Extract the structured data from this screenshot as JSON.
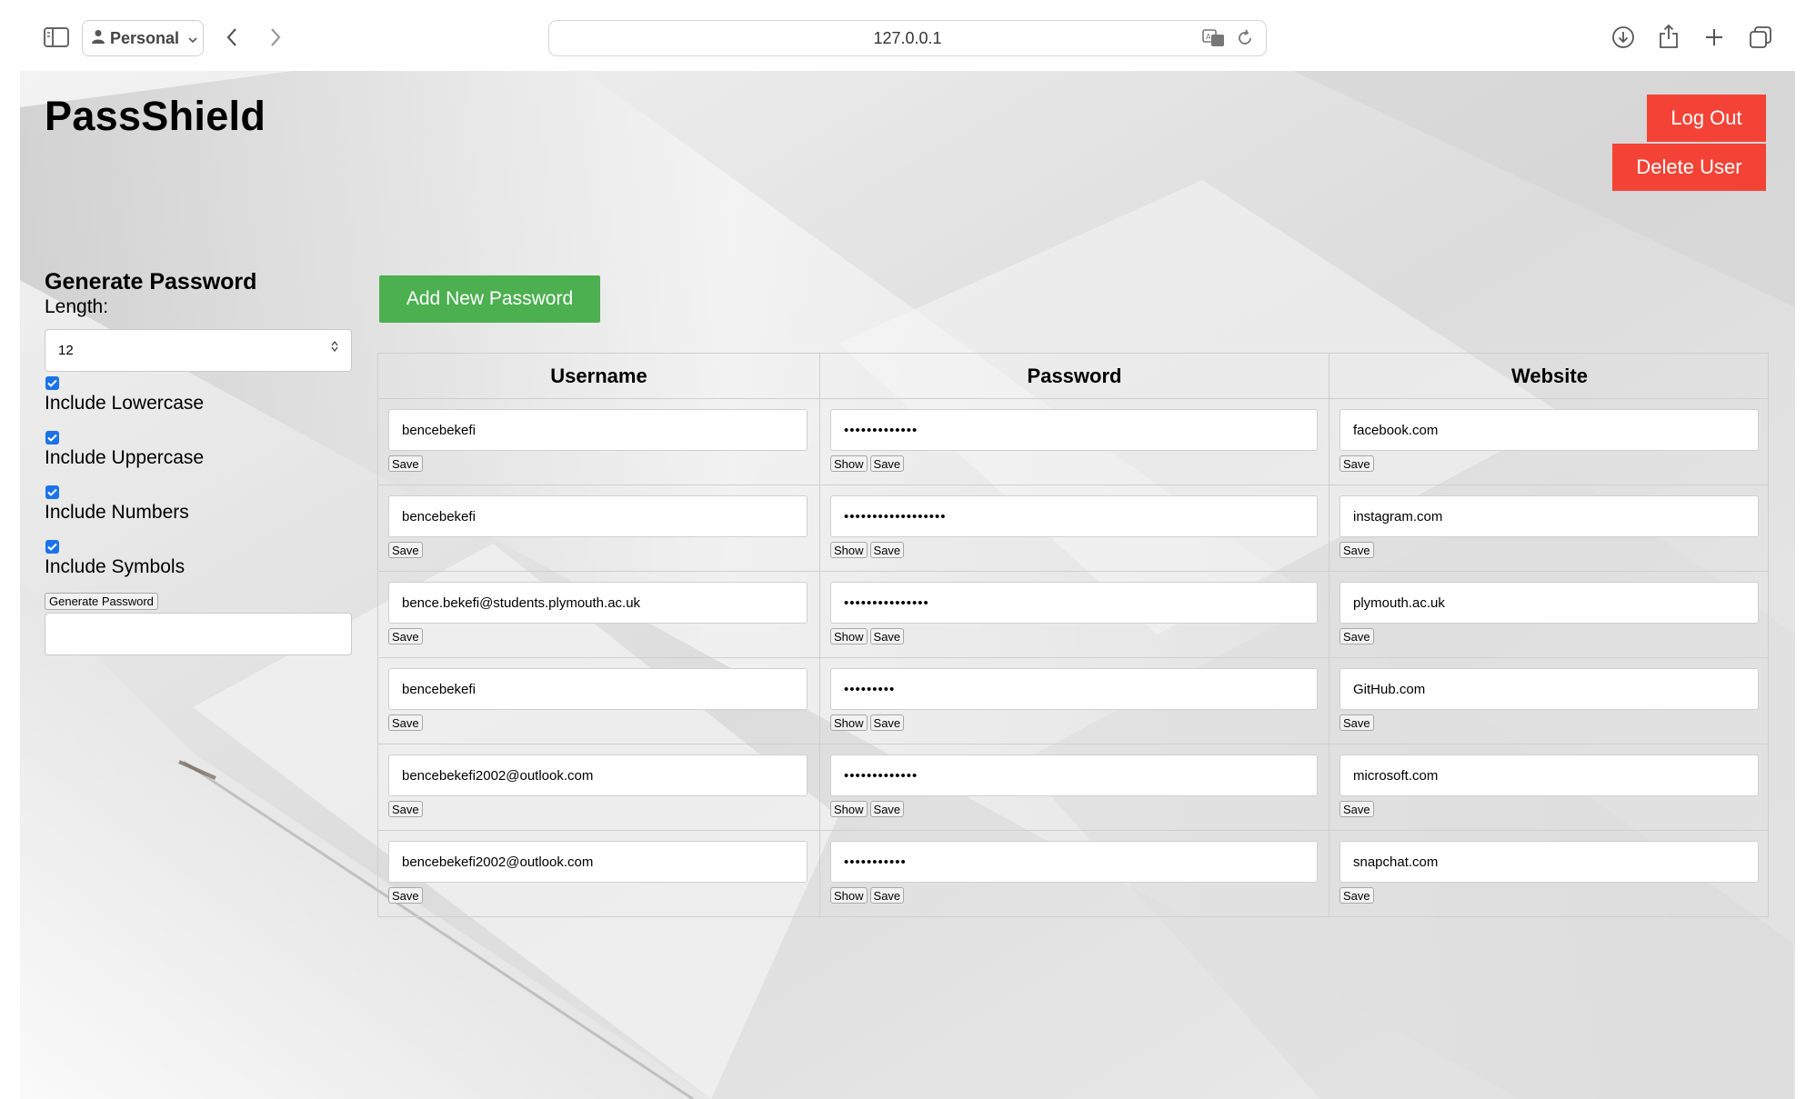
{
  "browser": {
    "profile_label": "Personal",
    "url": "127.0.0.1"
  },
  "app": {
    "title": "PassShield",
    "logout_label": "Log Out",
    "delete_user_label": "Delete User",
    "add_password_label": "Add New Password"
  },
  "generator": {
    "title": "Generate Password",
    "length_label": "Length:",
    "length_value": "12",
    "options": [
      {
        "label": "Include Lowercase",
        "checked": true
      },
      {
        "label": "Include Uppercase",
        "checked": true
      },
      {
        "label": "Include Numbers",
        "checked": true
      },
      {
        "label": "Include Symbols",
        "checked": true
      }
    ],
    "generate_label": "Generate Password",
    "output_value": ""
  },
  "table": {
    "headers": [
      "Username",
      "Password",
      "Website"
    ],
    "save_label": "Save",
    "show_label": "Show",
    "rows": [
      {
        "username": "bencebekefi",
        "password": "•••••••••••••",
        "website": "facebook.com"
      },
      {
        "username": "bencebekefi",
        "password": "••••••••••••••••••",
        "website": "instagram.com"
      },
      {
        "username": "bence.bekefi@students.plymouth.ac.uk",
        "password": "•••••••••••••••",
        "website": "plymouth.ac.uk"
      },
      {
        "username": "bencebekefi",
        "password": "•••••••••",
        "website": "GitHub.com"
      },
      {
        "username": "bencebekefi2002@outlook.com",
        "password": "•••••••••••••",
        "website": "microsoft.com"
      },
      {
        "username": "bencebekefi2002@outlook.com",
        "password": "•••••••••••",
        "website": "snapchat.com"
      }
    ]
  }
}
